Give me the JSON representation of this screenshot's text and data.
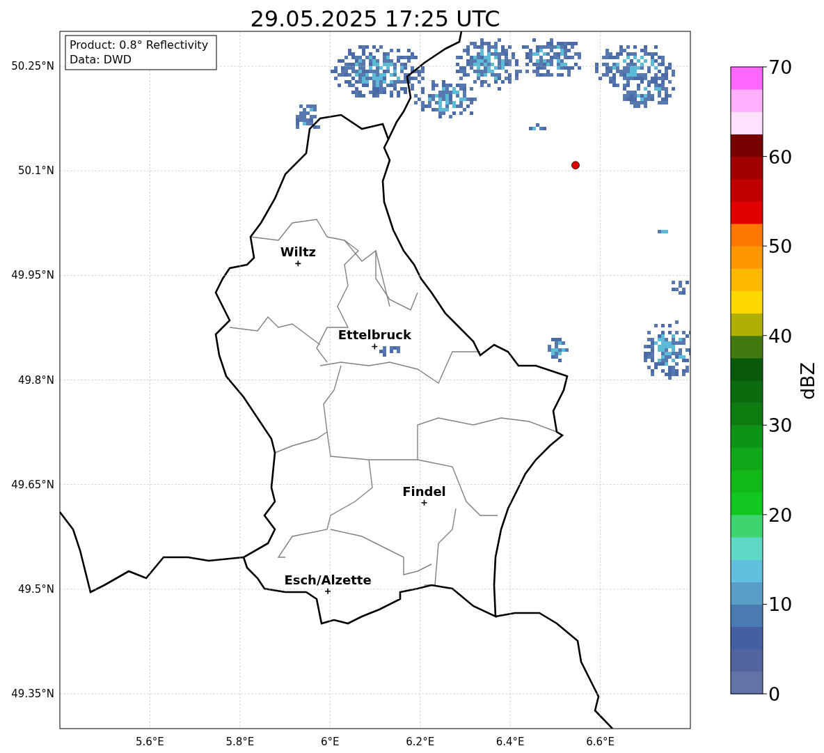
{
  "plot": {
    "info": {
      "product": "Product: 0.8° Reflectivity",
      "source": "Data: DWD"
    },
    "chart_data": {
      "type": "scatter",
      "title": "29.05.2025 17:25 UTC",
      "xlim": [
        5.4,
        6.8
      ],
      "ylim": [
        49.3,
        50.3
      ],
      "xticks": [
        {
          "value": 5.6,
          "label": "5.6°E"
        },
        {
          "value": 5.8,
          "label": "5.8°E"
        },
        {
          "value": 6.0,
          "label": "6°E"
        },
        {
          "value": 6.2,
          "label": "6.2°E"
        },
        {
          "value": 6.4,
          "label": "6.4°E"
        },
        {
          "value": 6.6,
          "label": "6.6°E"
        }
      ],
      "yticks": [
        {
          "value": 49.35,
          "label": "49.35°N"
        },
        {
          "value": 49.5,
          "label": "49.5°N"
        },
        {
          "value": 49.65,
          "label": "49.65°N"
        },
        {
          "value": 49.8,
          "label": "49.8°N"
        },
        {
          "value": 49.95,
          "label": "49.95°N"
        },
        {
          "value": 50.1,
          "label": "50.1°N"
        },
        {
          "value": 50.25,
          "label": "50.25°N"
        }
      ],
      "grid": true,
      "series": [
        {
          "color": "#000000",
          "x": [
            5.929,
            6.099,
            6.209,
            5.995
          ],
          "values": [
            49.967,
            49.848,
            49.624,
            49.497
          ]
        },
        {
          "color": "#e00000",
          "x": [
            6.545
          ],
          "values": [
            50.108
          ]
        }
      ],
      "annotations": [
        {
          "text": "Wiltz",
          "x": 5.929,
          "y": 49.967
        },
        {
          "text": "Ettelbruck",
          "x": 6.099,
          "y": 49.848
        },
        {
          "text": "Findel",
          "x": 6.209,
          "y": 49.624
        },
        {
          "text": "Esch/Alzette",
          "x": 5.995,
          "y": 49.497
        }
      ]
    }
  },
  "colorbar": {
    "label": "dBZ",
    "ticks": [
      "70",
      "60",
      "50",
      "40",
      "30",
      "20",
      "10",
      "0"
    ]
  }
}
